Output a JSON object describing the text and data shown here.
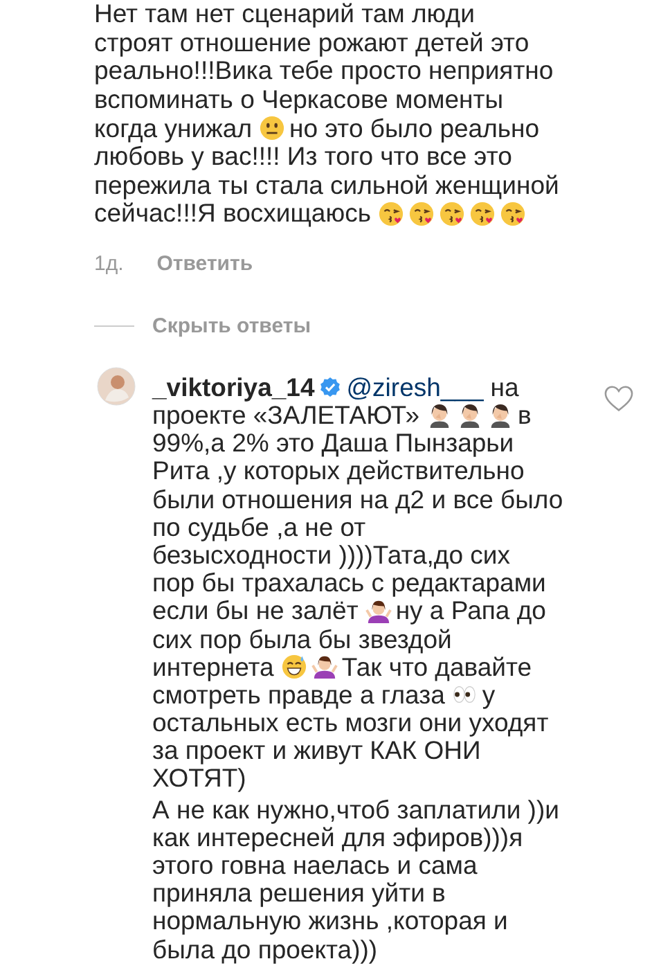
{
  "comment": {
    "lines": [
      [
        {
          "kind": "text",
          "text": "Нет там нет сценарий там люди"
        }
      ],
      [
        {
          "kind": "text",
          "text": "строят отношение рожают детей это"
        }
      ],
      [
        {
          "kind": "text",
          "text": "реально!!!Вика тебе просто неприятно"
        }
      ],
      [
        {
          "kind": "text",
          "text": "вспоминать о Черкасове  моменты"
        }
      ],
      [
        {
          "kind": "text",
          "text": "когда унижал"
        },
        {
          "kind": "neutral"
        },
        {
          "kind": "text",
          "text": "но это было реально"
        }
      ],
      [
        {
          "kind": "text",
          "text": "любовь у вас!!!! Из того что все это"
        }
      ],
      [
        {
          "kind": "text",
          "text": "пережила ты стала сильной женщиной"
        }
      ],
      [
        {
          "kind": "text",
          "text": "сейчас!!!Я восхищаюсь"
        },
        {
          "kind": "kiss"
        },
        {
          "kind": "kiss"
        },
        {
          "kind": "kiss"
        },
        {
          "kind": "kiss"
        },
        {
          "kind": "kiss"
        }
      ]
    ],
    "time": "1д.",
    "reply_button": "Ответить"
  },
  "hide_replies": "Скрыть ответы",
  "reply": {
    "username": "_viktoriya_14",
    "verified": true,
    "liked": false,
    "paragraphs": [
      [
        [
          {
            "kind": "mention",
            "text": "@ziresh___"
          },
          {
            "kind": "text",
            "text": "на"
          }
        ],
        [
          {
            "kind": "text",
            "text": "проекте «ЗАЛЕТАЮТ»"
          },
          {
            "kind": "facepalm"
          },
          {
            "kind": "facepalm"
          },
          {
            "kind": "facepalm"
          },
          {
            "kind": "text",
            "text": "в"
          }
        ],
        [
          {
            "kind": "text",
            "text": "99%,а 2% это Даша Пынзарьи"
          }
        ],
        [
          {
            "kind": "text",
            "text": "Рита ,у которых действительно"
          }
        ],
        [
          {
            "kind": "text",
            "text": "были отношения на д2 и все было"
          }
        ],
        [
          {
            "kind": "text",
            "text": "по судьбе ,а не от"
          }
        ],
        [
          {
            "kind": "text",
            "text": "безысходности ))))Тата,до сих"
          }
        ],
        [
          {
            "kind": "text",
            "text": "пор бы трахалась с редактарами"
          }
        ],
        [
          {
            "kind": "text",
            "text": "если бы не залёт"
          },
          {
            "kind": "shrug"
          },
          {
            "kind": "text",
            "text": "ну а Рапа до"
          }
        ],
        [
          {
            "kind": "text",
            "text": "сих пор была бы звездой"
          }
        ],
        [
          {
            "kind": "text",
            "text": "интернета"
          },
          {
            "kind": "sweat-grin"
          },
          {
            "kind": "shrug"
          },
          {
            "kind": "text",
            "text": "Так что давайте"
          }
        ],
        [
          {
            "kind": "text",
            "text": "смотреть правде а глаза"
          },
          {
            "kind": "eyes"
          },
          {
            "kind": "text",
            "text": "у"
          }
        ],
        [
          {
            "kind": "text",
            "text": "остальных есть мозги они уходят"
          }
        ],
        [
          {
            "kind": "text",
            "text": "за проект и живут КАК ОНИ"
          }
        ],
        [
          {
            "kind": "text",
            "text": "ХОТЯТ)"
          }
        ]
      ],
      [
        [
          {
            "kind": "text",
            "text": "А не как нужно,чтоб заплатили ))и"
          }
        ],
        [
          {
            "kind": "text",
            "text": "как интересней для эфиров)))я"
          }
        ],
        [
          {
            "kind": "text",
            "text": "этого говна наелась и сама"
          }
        ],
        [
          {
            "kind": "text",
            "text": "приняла решения уйти в"
          }
        ],
        [
          {
            "kind": "text",
            "text": "нормальную жизнь ,которая и"
          }
        ],
        [
          {
            "kind": "text",
            "text": "была до проекта)))"
          }
        ]
      ]
    ]
  }
}
